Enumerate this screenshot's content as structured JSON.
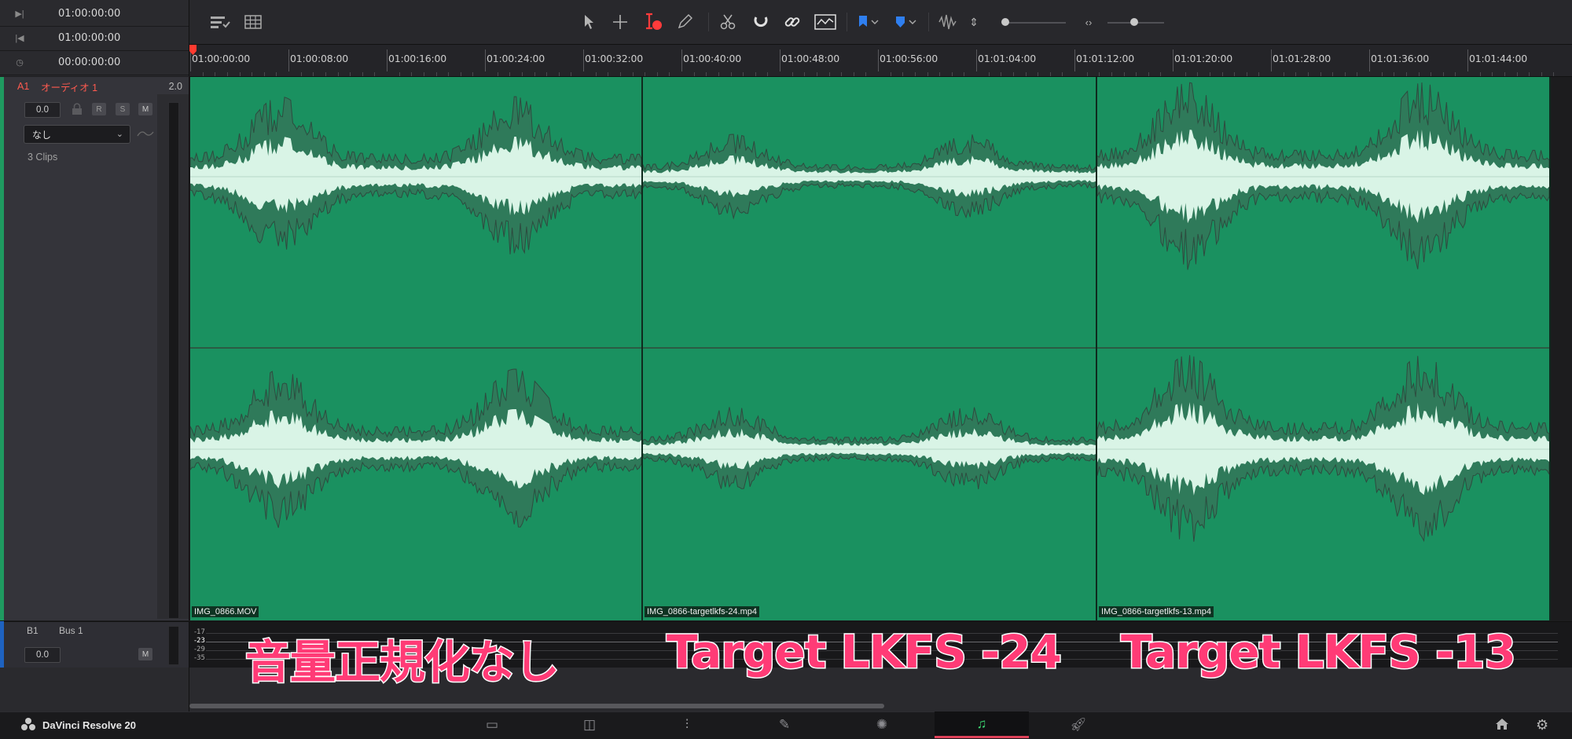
{
  "timecodes": [
    {
      "icon": "play-to-end-icon",
      "value": "01:00:00:00"
    },
    {
      "icon": "jump-start-icon",
      "value": "01:00:00:00"
    },
    {
      "icon": "clock-icon",
      "value": "00:00:00:00"
    }
  ],
  "toolbar": {
    "icons": [
      "timeline-view-options-icon",
      "grid-icon",
      "select-arrow-icon",
      "range-select-icon",
      "trim-edit-icon",
      "pencil-icon",
      "blade-icon",
      "snapping-icon",
      "link-icon",
      "waveform-zoom-icon",
      "flag-icon",
      "marker-icon",
      "audio-waveform-icon",
      "expand-icon",
      "zoom-slider",
      "fit-icon",
      "height-slider"
    ]
  },
  "ruler": {
    "ticks": [
      "01:00:00:00",
      "01:00:08:00",
      "01:00:16:00",
      "01:00:24:00",
      "01:00:32:00",
      "01:00:40:00",
      "01:00:48:00",
      "01:00:56:00",
      "01:01:04:00",
      "01:01:12:00",
      "01:01:20:00",
      "01:01:28:00",
      "01:01:36:00",
      "01:01:44:00"
    ]
  },
  "track_a1": {
    "id": "A1",
    "name": "オーディオ 1",
    "channels": "2.0",
    "volume": "0.0",
    "buttons": {
      "r": "R",
      "s": "S",
      "m": "M"
    },
    "effect": "なし",
    "clip_count": "3 Clips",
    "colors": {
      "stripe": "#1f9a60",
      "label": "#ff5a4f"
    }
  },
  "clips": [
    {
      "name": "IMG_0866.MOV",
      "loudness": "high"
    },
    {
      "name": "IMG_0866-targetlkfs-24.mp4",
      "loudness": "low"
    },
    {
      "name": "IMG_0866-targetlkfs-13.mp4",
      "loudness": "max"
    }
  ],
  "track_b1": {
    "id": "B1",
    "name": "Bus 1",
    "volume": "0.0",
    "mute": "M",
    "scale": [
      "-17",
      "-23",
      "-29",
      "-35"
    ],
    "colors": {
      "stripe": "#1e62c0"
    }
  },
  "overlay_labels": [
    "音量正規化なし",
    "Target LKFS -24",
    "Target LKFS -13"
  ],
  "bottom_bar": {
    "app_name": "DaVinci Resolve 20",
    "pages": [
      "media-page-icon",
      "cut-page-icon",
      "edit-page-icon",
      "fusion-page-icon",
      "color-page-icon",
      "fairlight-page-icon",
      "deliver-page-icon"
    ],
    "active_page": "fairlight-page-icon",
    "right_icons": [
      "home-icon",
      "settings-gear-icon"
    ]
  },
  "colors": {
    "clip_green": "#1a9160",
    "waveform": "#d9f4e6",
    "overlay_pink": "#ff3b76"
  }
}
